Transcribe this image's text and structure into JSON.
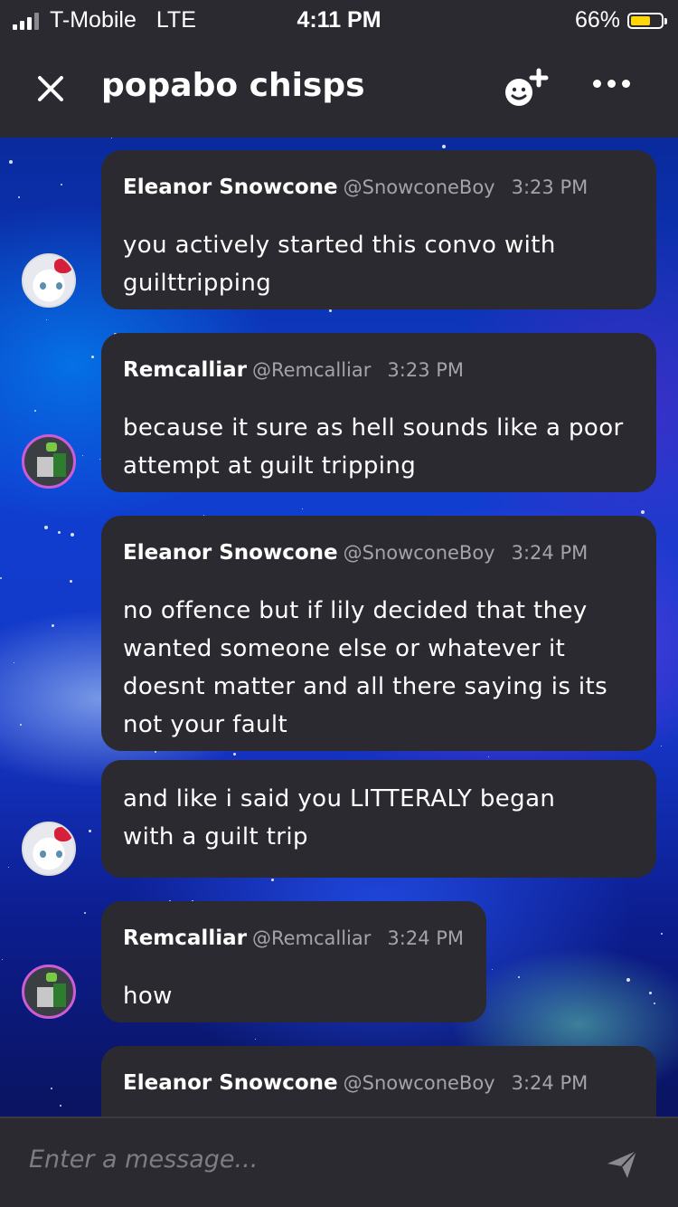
{
  "status_bar": {
    "carrier": "T-Mobile",
    "network": "LTE",
    "time": "4:11 PM",
    "battery_percent_label": "66%",
    "battery_level": 0.66,
    "battery_color": "#ffd60a"
  },
  "header": {
    "title": "popabo chisps",
    "close_icon": "close-icon",
    "add_member_icon": "smiley-plus-icon",
    "more_icon": "more-dots-icon"
  },
  "messages": [
    {
      "author": "Eleanor Snowcone",
      "handle": "@SnowconeBoy",
      "time": "3:23 PM",
      "lines": [
        "you actively started this convo with",
        "guilttripping"
      ]
    },
    {
      "author": "Remcalliar",
      "handle": "@Remcalliar",
      "time": "3:23 PM",
      "lines": [
        "because it sure as hell sounds like a poor",
        "attempt at guilt tripping"
      ]
    },
    {
      "author": "Eleanor Snowcone",
      "handle": "@SnowconeBoy",
      "time": "3:24 PM",
      "lines": [
        "no offence but if lily decided that they",
        "wanted someone else or whatever it",
        "doesnt matter and all there saying is its",
        "not your fault"
      ]
    },
    {
      "lines": [
        "and like i said you LITTERALY began",
        "with a guilt trip"
      ]
    },
    {
      "author": "Remcalliar",
      "handle": "@Remcalliar",
      "time": "3:24 PM",
      "lines": [
        "how"
      ]
    },
    {
      "author": "Eleanor Snowcone",
      "handle": "@SnowconeBoy",
      "time": "3:24 PM",
      "lines": []
    }
  ],
  "composer": {
    "placeholder": "Enter a message...",
    "send_icon": "send-icon"
  },
  "colors": {
    "panel": "#2c2a31",
    "muted_text": "#a4a3ab",
    "accent_border": "#d05bd6"
  }
}
